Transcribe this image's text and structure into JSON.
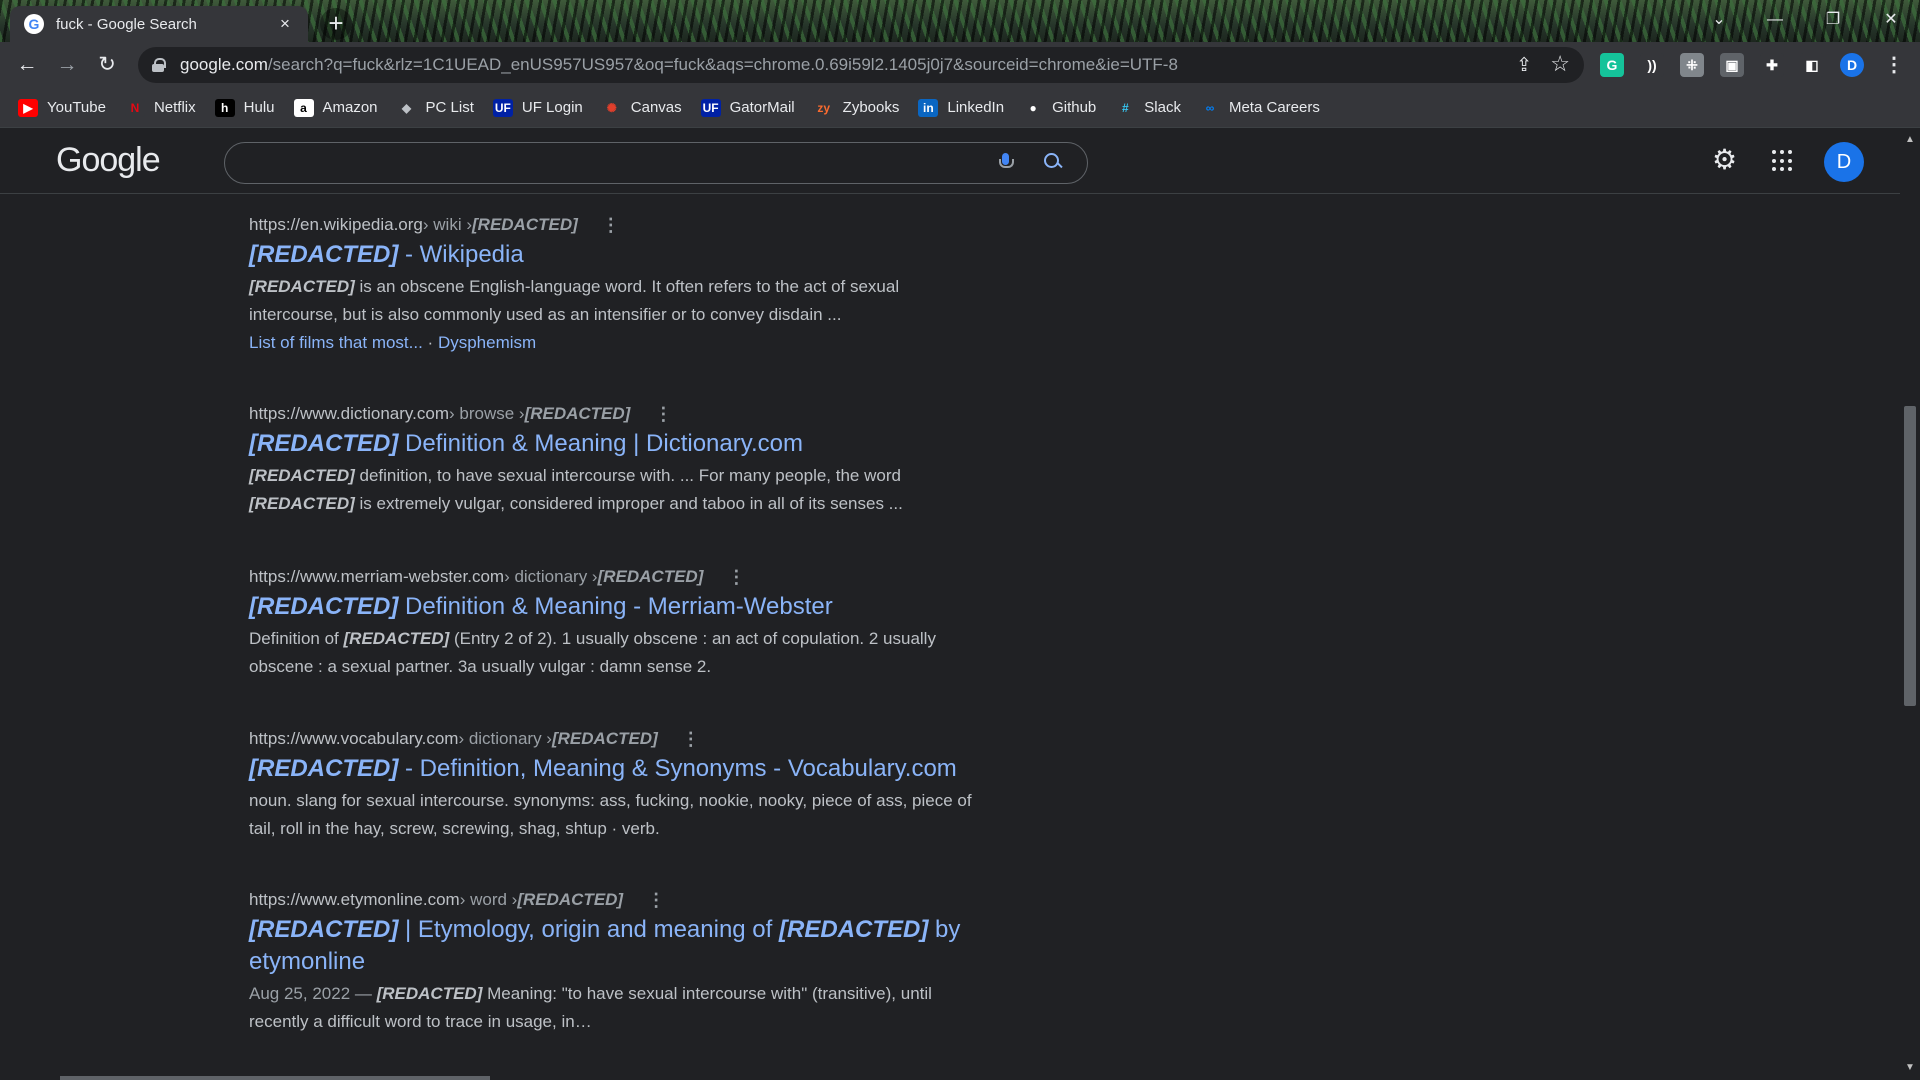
{
  "tab": {
    "title": "fuck - Google Search",
    "favicon": "G",
    "close": "×",
    "new_tab": "+"
  },
  "window": {
    "chevron": "⌄",
    "minimize": "—",
    "restore": "❐",
    "close": "✕"
  },
  "toolbar": {
    "back": "←",
    "forward": "→",
    "reload": "↻",
    "url_host": "google.com",
    "url_rest": "/search?q=fuck&rlz=1C1UEAD_enUS957US957&oq=fuck&aqs=chrome.0.69i59l2.1405j0j7&sourceid=chrome&ie=UTF-8",
    "share": "⇪",
    "star": "☆",
    "profile": "D",
    "menu": "⋮"
  },
  "extensions": [
    {
      "name": "grammarly-icon",
      "glyph": "G",
      "color": "#15c39a"
    },
    {
      "name": "read-aloud-icon",
      "glyph": "))",
      "color": "#35363a"
    },
    {
      "name": "puzzle-ext-icon",
      "glyph": "⁜",
      "color": "#80868b"
    },
    {
      "name": "screen-ext-icon",
      "glyph": "▣",
      "color": "#5f6368"
    },
    {
      "name": "extensions-icon",
      "glyph": "✚",
      "color": "#35363a"
    },
    {
      "name": "side-panel-icon",
      "glyph": "◧",
      "color": "#35363a"
    }
  ],
  "bookmarks": [
    {
      "label": "YouTube",
      "glyph": "▶",
      "color": "#ff0000"
    },
    {
      "label": "Netflix",
      "glyph": "N",
      "color": "#35363a",
      "fg": "#e50914"
    },
    {
      "label": "Hulu",
      "glyph": "h",
      "color": "#000000"
    },
    {
      "label": "Amazon",
      "glyph": "a",
      "color": "#ffffff",
      "fg": "#000000"
    },
    {
      "label": "PC List",
      "glyph": "◆",
      "color": "#35363a",
      "fg": "#bdc1c6"
    },
    {
      "label": "UF Login",
      "glyph": "UF",
      "color": "#0021a5"
    },
    {
      "label": "Canvas",
      "glyph": "✺",
      "color": "#35363a",
      "fg": "#e13f2b"
    },
    {
      "label": "GatorMail",
      "glyph": "UF",
      "color": "#0021a5"
    },
    {
      "label": "Zybooks",
      "glyph": "zy",
      "color": "#35363a",
      "fg": "#fa6b2f"
    },
    {
      "label": "LinkedIn",
      "glyph": "in",
      "color": "#0a66c2"
    },
    {
      "label": "Github",
      "glyph": "●",
      "color": "#35363a",
      "fg": "#ffffff"
    },
    {
      "label": "Slack",
      "glyph": "#",
      "color": "#35363a",
      "fg": "#36c5f0"
    },
    {
      "label": "Meta Careers",
      "glyph": "∞",
      "color": "#35363a",
      "fg": "#0081fb"
    }
  ],
  "google": {
    "logo": "Google",
    "search_value": "",
    "settings": "⚙",
    "avatar": "D"
  },
  "results": [
    {
      "url_host": "https://en.wikipedia.org",
      "url_path": " › wiki › ",
      "url_term": "[REDACTED]",
      "title_em": "[REDACTED]",
      "title_rest": " - Wikipedia",
      "snippet_lines": [
        {
          "em": "[REDACTED]",
          "text": " is an obscene English-language word. It often refers to the act of sexual"
        },
        {
          "em": "",
          "text": "intercourse, but is also commonly used as an intensifier or to convey disdain ..."
        }
      ],
      "sitelinks": [
        "List of films that most...",
        "Dysphemism"
      ]
    },
    {
      "url_host": "https://www.dictionary.com",
      "url_path": " › browse › ",
      "url_term": "[REDACTED]",
      "title_em": "[REDACTED]",
      "title_rest": " Definition & Meaning | Dictionary.com",
      "snippet_lines": [
        {
          "em": "[REDACTED]",
          "text": " definition, to have sexual intercourse with. ... For many people, the word"
        },
        {
          "em": "[REDACTED]",
          "text": " is extremely vulgar, considered improper and taboo in all of its senses ..."
        }
      ]
    },
    {
      "url_host": "https://www.merriam-webster.com",
      "url_path": " › dictionary › ",
      "url_term": "[REDACTED]",
      "title_em": "[REDACTED]",
      "title_rest": " Definition & Meaning - Merriam-Webster",
      "snippet_lines": [
        {
          "pre": "Definition of ",
          "em": "[REDACTED]",
          "text": " (Entry 2 of 2). 1 usually obscene : an act of copulation. 2 usually"
        },
        {
          "em": "",
          "text": "obscene : a sexual partner. 3a usually vulgar : damn sense 2."
        }
      ]
    },
    {
      "url_host": "https://www.vocabulary.com",
      "url_path": " › dictionary › ",
      "url_term": "[REDACTED]",
      "title_em": "[REDACTED]",
      "title_rest": " - Definition, Meaning & Synonyms - Vocabulary.com",
      "snippet_lines": [
        {
          "em": "",
          "text": "noun. slang for sexual intercourse. synonyms: ass, fucking, nookie, nooky, piece of ass, piece of"
        },
        {
          "em": "",
          "text": "tail, roll in the hay, screw, screwing, shag, shtup · verb."
        }
      ]
    },
    {
      "url_host": "https://www.etymonline.com",
      "url_path": " › word › ",
      "url_term": "[REDACTED]",
      "title_em": "[REDACTED]",
      "title_mid": " | Etymology, origin and meaning of ",
      "title_em2": "[REDACTED]",
      "title_rest": " by",
      "title_line2": "etymonline",
      "date": "Aug 25, 2022 — ",
      "snippet_lines": [
        {
          "em": "[REDACTED]",
          "text": " Meaning: \"to have sexual intercourse with\" (transitive), until"
        },
        {
          "em": "",
          "text": "recently a difficult word to trace in usage, in…"
        }
      ]
    }
  ],
  "scrollbar": {
    "up": "▲",
    "down": "▼"
  }
}
